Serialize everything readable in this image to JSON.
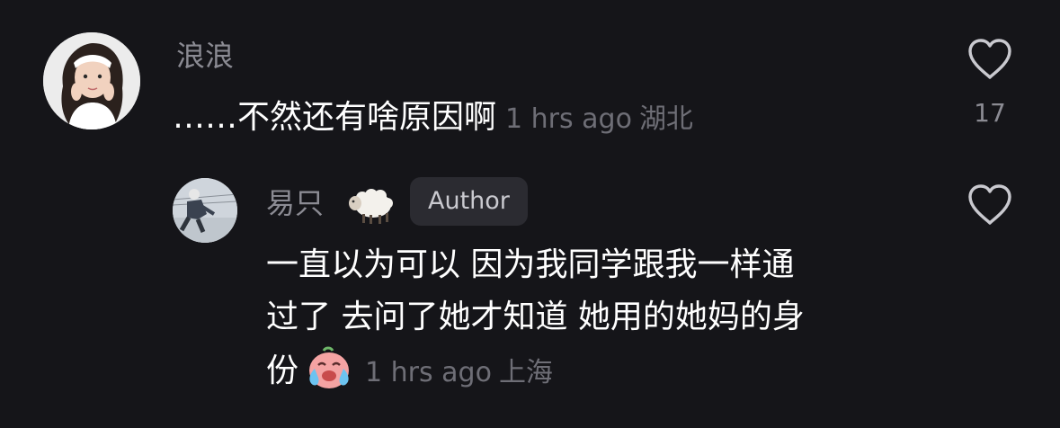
{
  "comments": [
    {
      "username": "浪浪",
      "text": "……不然还有啥原因啊",
      "time": "1 hrs ago",
      "location": "湖北",
      "likes": "17",
      "avatar_icon": "girl-avatar"
    }
  ],
  "reply": {
    "username": "易只",
    "username_emoji": "sheep-emoji",
    "badge": "Author",
    "text_lines": [
      "一直以为可以 因为我同学跟我一样通",
      "过了 去问了她才知道 她用的她妈的身",
      "份"
    ],
    "trailing_emoji": "crying-face-emoji",
    "time": "1 hrs ago",
    "location": "上海",
    "avatar_icon": "person-crouching-avatar"
  },
  "colors": {
    "background": "#151519",
    "text_primary": "#ffffff",
    "text_secondary": "#8b8b93",
    "meta": "#6e6e76",
    "badge_bg": "#2b2b31"
  }
}
